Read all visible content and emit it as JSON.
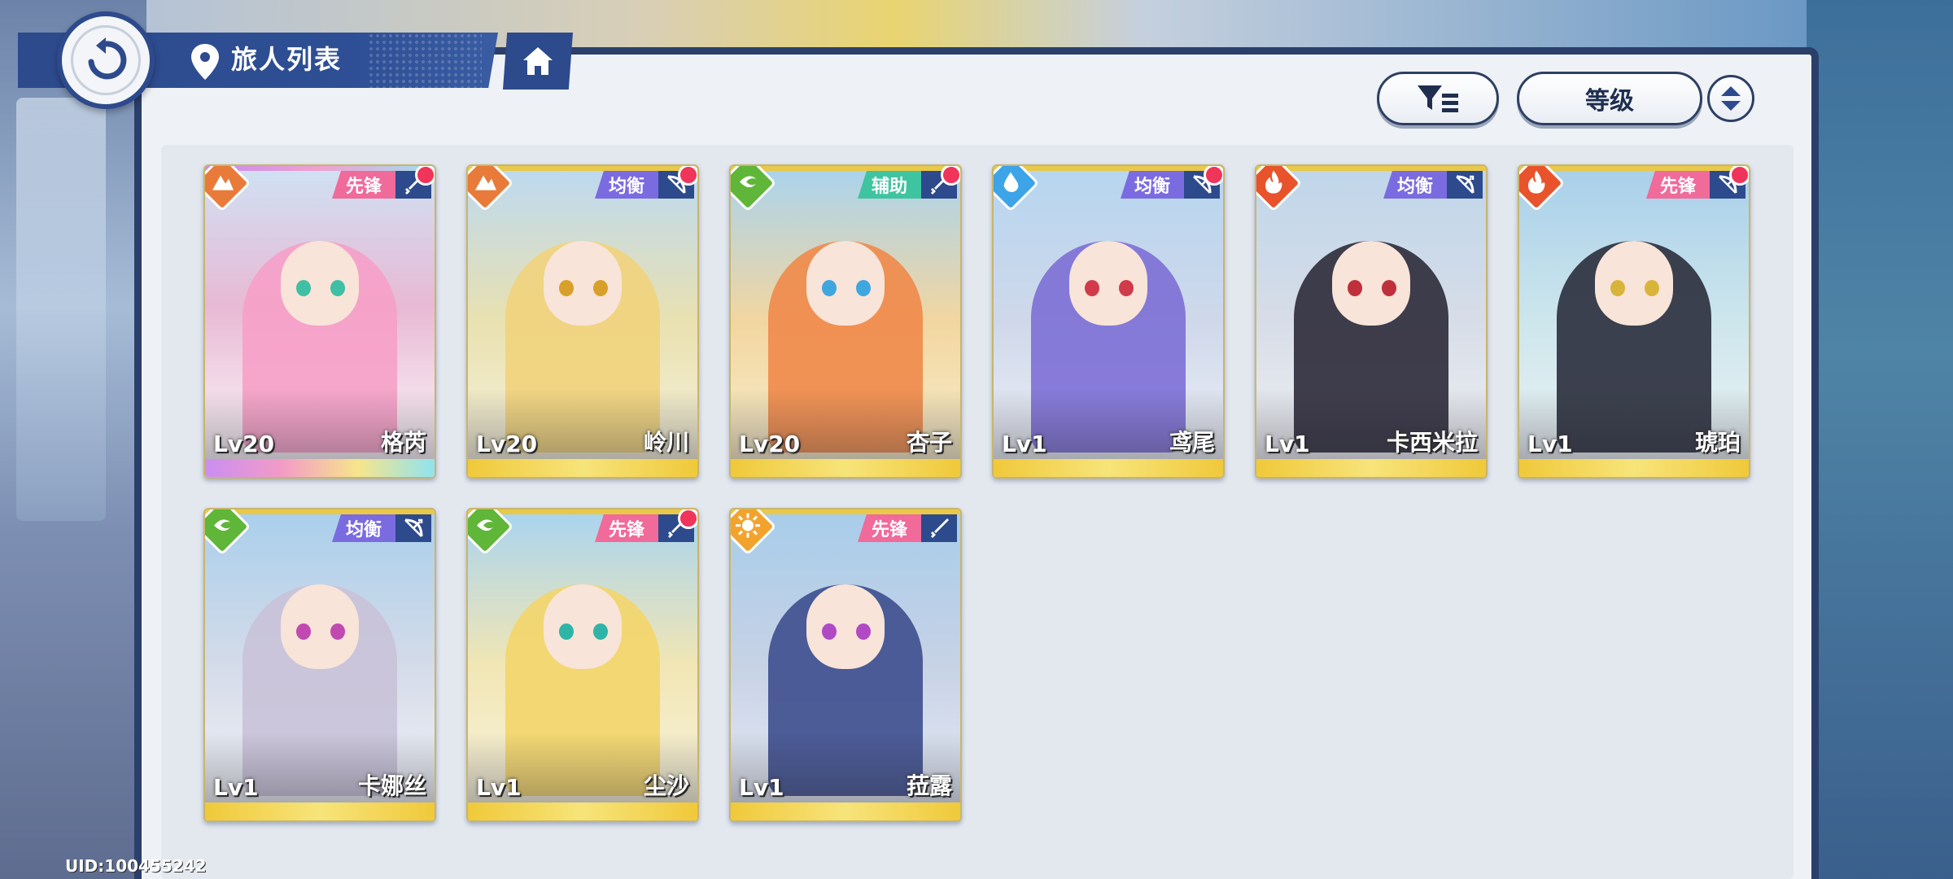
{
  "header": {
    "title": "旅人列表",
    "uid": "UID:100455242"
  },
  "toolbar": {
    "sort_label": "等级"
  },
  "colors": {
    "navy": "#2d4a8c",
    "element_earth": "#e87b3a",
    "element_wind": "#5fb638",
    "element_water": "#3da4e8",
    "element_fire": "#e8532b",
    "element_light": "#f2a32e",
    "role_vanguard": "#f06a9a",
    "role_balance": "#7b6be0",
    "role_support": "#3fc4a0",
    "notify": "#f0345a"
  },
  "characters": [
    {
      "name": "格芮",
      "level": "Lv20",
      "role": "先锋",
      "element": "earth-icon",
      "weapon": "sword-icon",
      "notify": true,
      "rarity": "rainbow"
    },
    {
      "name": "岭川",
      "level": "Lv20",
      "role": "均衡",
      "element": "earth-icon",
      "weapon": "bow-icon",
      "notify": true,
      "rarity": "gold"
    },
    {
      "name": "杏子",
      "level": "Lv20",
      "role": "辅助",
      "element": "wind-icon",
      "weapon": "sword-icon",
      "notify": true,
      "rarity": "gold"
    },
    {
      "name": "鸢尾",
      "level": "Lv1",
      "role": "均衡",
      "element": "water-icon",
      "weapon": "bow-icon",
      "notify": true,
      "rarity": "gold"
    },
    {
      "name": "卡西米拉",
      "level": "Lv1",
      "role": "均衡",
      "element": "fire-icon",
      "weapon": "bow-icon",
      "notify": false,
      "rarity": "gold"
    },
    {
      "name": "琥珀",
      "level": "Lv1",
      "role": "先锋",
      "element": "fire-icon",
      "weapon": "bow-icon",
      "notify": true,
      "rarity": "gold"
    },
    {
      "name": "卡娜丝",
      "level": "Lv1",
      "role": "均衡",
      "element": "wind-icon",
      "weapon": "bow-icon",
      "notify": false,
      "rarity": "gold"
    },
    {
      "name": "尘沙",
      "level": "Lv1",
      "role": "先锋",
      "element": "wind-icon",
      "weapon": "sword-icon",
      "notify": true,
      "rarity": "gold"
    },
    {
      "name": "菈露",
      "level": "Lv1",
      "role": "先锋",
      "element": "light-icon",
      "weapon": "sword-icon",
      "notify": false,
      "rarity": "gold"
    }
  ]
}
